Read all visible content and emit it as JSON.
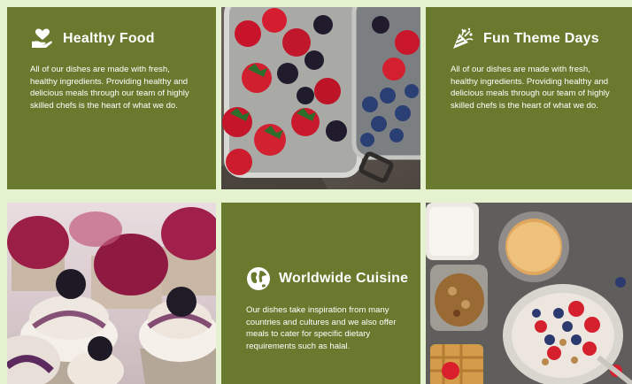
{
  "tiles": {
    "healthy": {
      "title": "Healthy Food",
      "body": "All of our dishes are made with fresh, healthy ingredients. Providing healthy and delicious meals through our team of highly skilled chefs is the heart of what we do.",
      "icon": "heart-hand-icon"
    },
    "berries_photo": {
      "icon": "berries-photo"
    },
    "fun": {
      "title": "Fun Theme Days",
      "body": "All of our dishes are made with fresh, healthy ingredients. Providing healthy and delicious meals through our team of highly skilled chefs is the heart of what we do.",
      "icon": "party-popper-icon"
    },
    "cupcakes_photo": {
      "icon": "cupcakes-photo"
    },
    "world": {
      "title": "Worldwide Cuisine",
      "body": "Our dishes take inspiration from many countries and cultures and we also offer meals to cater for specific dietary requirements such as halal.",
      "icon": "globe-icon"
    },
    "breakfast_photo": {
      "icon": "breakfast-photo"
    }
  },
  "colors": {
    "tile_green": "#697a2e",
    "page_bg": "#e4f2cf",
    "text": "#ffffff"
  }
}
